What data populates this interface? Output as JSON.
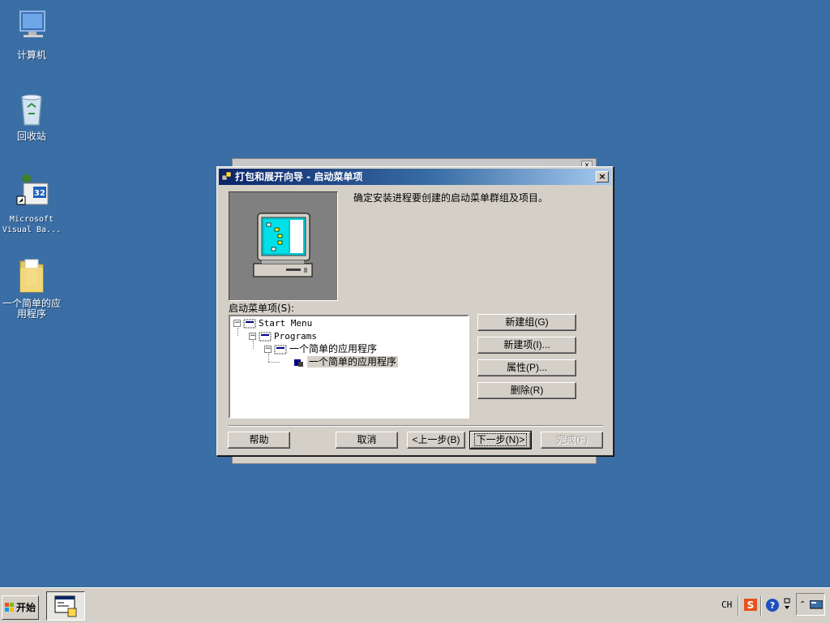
{
  "desktop": {
    "icons": [
      {
        "label": "计算机"
      },
      {
        "label": "回收站"
      },
      {
        "label": "Microsoft Visual Ba..."
      },
      {
        "label": "一个简单的应用程序"
      }
    ]
  },
  "dialog": {
    "title": "打包和展开向导 - 启动菜单项",
    "close_glyph": "×",
    "intro_text": "确定安装进程要创建的启动菜单群组及项目。",
    "tree_label": "启动菜单项(S):",
    "tree": [
      {
        "text": "Start Menu",
        "expanded": true
      },
      {
        "text": "Programs",
        "expanded": true
      },
      {
        "text": "一个简单的应用程序",
        "expanded": true
      },
      {
        "text": "一个简单的应用程序",
        "selected": true
      }
    ],
    "buttons": {
      "new_group": "新建组(G)",
      "new_item": "新建项(I)...",
      "properties": "属性(P)...",
      "delete": "删除(R)",
      "help": "帮助",
      "cancel": "取消",
      "back": "<上一步(B)",
      "next": "下一步(N)>",
      "finish": "完成(F)"
    }
  },
  "taskbar": {
    "start_label": "开始",
    "tray": {
      "lang": "CH",
      "ime_icon": "sogou-ime-icon",
      "help_icon": "help-icon"
    }
  },
  "colors": {
    "desktop": "#3a6ea5",
    "title_active": "#0a246a",
    "face": "#d4d0c8"
  }
}
